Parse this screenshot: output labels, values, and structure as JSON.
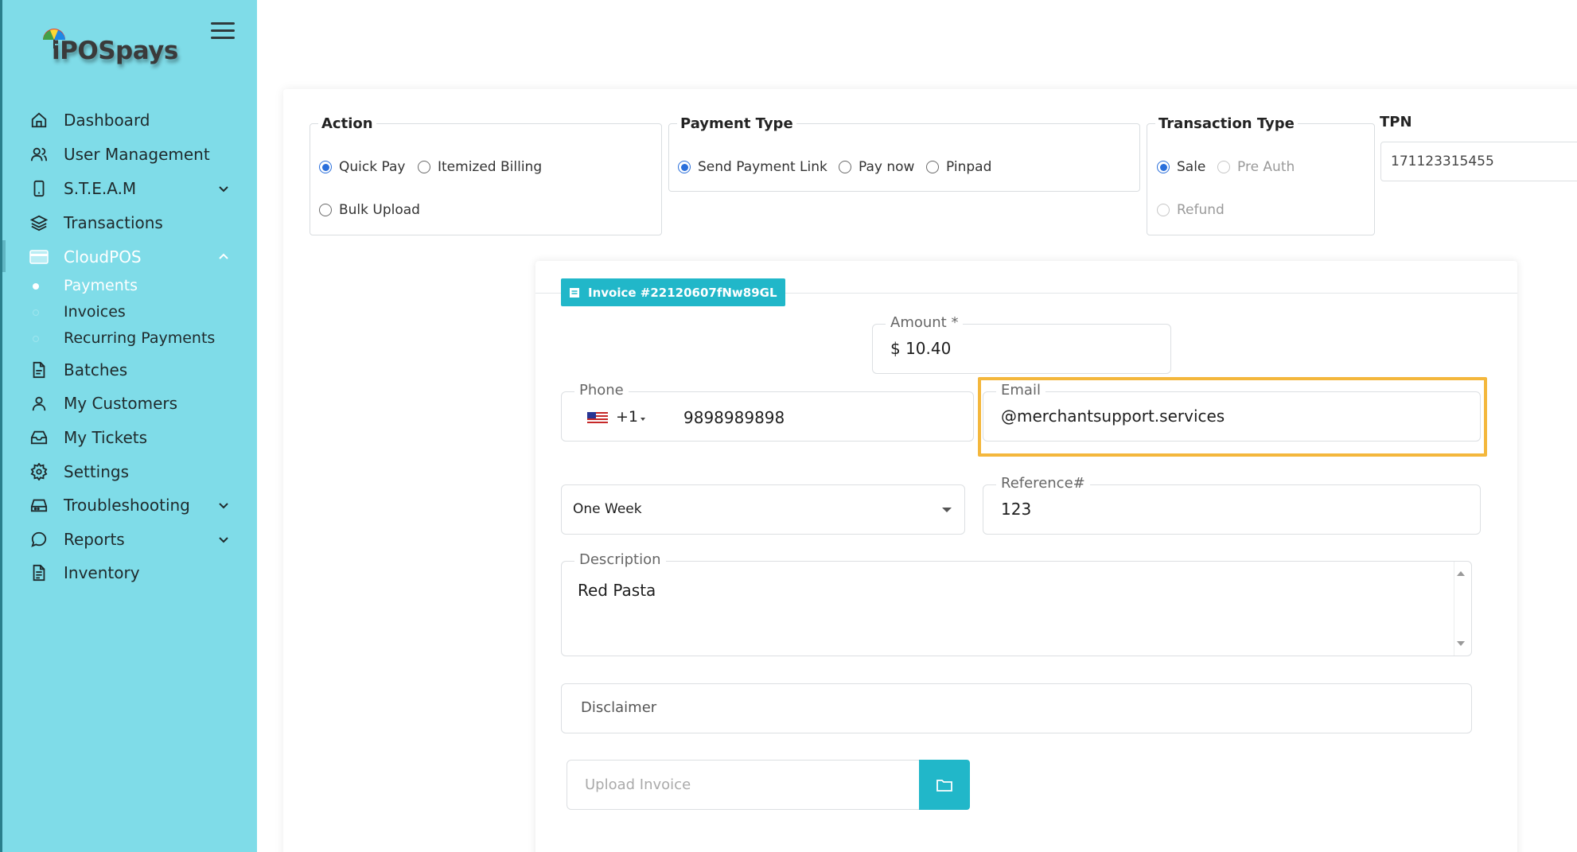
{
  "brand": {
    "logo_text": "iPOSpays"
  },
  "sidebar": {
    "items": [
      {
        "label": "Dashboard",
        "icon": "home-icon"
      },
      {
        "label": "User Management",
        "icon": "users-icon"
      },
      {
        "label": "S.T.E.A.M",
        "icon": "mobile-icon",
        "has_chevron": true
      },
      {
        "label": "Transactions",
        "icon": "layers-icon"
      },
      {
        "label": "CloudPOS",
        "icon": "card-icon",
        "active": true,
        "expanded": true
      },
      {
        "label": "Batches",
        "icon": "file-icon"
      },
      {
        "label": "My Customers",
        "icon": "user-icon"
      },
      {
        "label": "My Tickets",
        "icon": "inbox-icon"
      },
      {
        "label": "Settings",
        "icon": "gear-icon"
      },
      {
        "label": "Troubleshooting",
        "icon": "drive-icon",
        "has_chevron": true
      },
      {
        "label": "Reports",
        "icon": "chat-icon",
        "has_chevron": true
      },
      {
        "label": "Inventory",
        "icon": "document-icon"
      }
    ],
    "cloudpos_sub": [
      {
        "label": "Payments",
        "active": true
      },
      {
        "label": "Invoices"
      },
      {
        "label": "Recurring Payments"
      }
    ]
  },
  "action": {
    "legend": "Action",
    "options": [
      "Quick Pay",
      "Itemized Billing",
      "Bulk Upload"
    ],
    "selected": "Quick Pay"
  },
  "payment_type": {
    "legend": "Payment Type",
    "options": [
      "Send Payment Link",
      "Pay now",
      "Pinpad"
    ],
    "selected": "Send Payment Link"
  },
  "transaction_type": {
    "legend": "Transaction Type",
    "options": [
      "Sale",
      "Pre Auth",
      "Refund"
    ],
    "selected": "Sale"
  },
  "tpn": {
    "label": "TPN",
    "value": "171123315455"
  },
  "invoice": {
    "badge": "Invoice #22120607fNw89GL",
    "amount": {
      "label": "Amount *",
      "value": "$ 10.40"
    },
    "phone": {
      "label": "Phone",
      "country_code": "+1",
      "value": "9898989898"
    },
    "email": {
      "label": "Email",
      "value": "@merchantsupport.services"
    },
    "expiry": {
      "value": "One Week"
    },
    "reference": {
      "label": "Reference#",
      "value": "123"
    },
    "description": {
      "label": "Description",
      "value": "Red Pasta"
    },
    "disclaimer": {
      "placeholder": "Disclaimer"
    },
    "upload": {
      "placeholder": "Upload Invoice"
    }
  },
  "colors": {
    "sidebar_bg": "#7fdce8",
    "accent": "#21b7c9",
    "radio_checked": "#2a6fdb",
    "highlight": "#f4b73c"
  }
}
